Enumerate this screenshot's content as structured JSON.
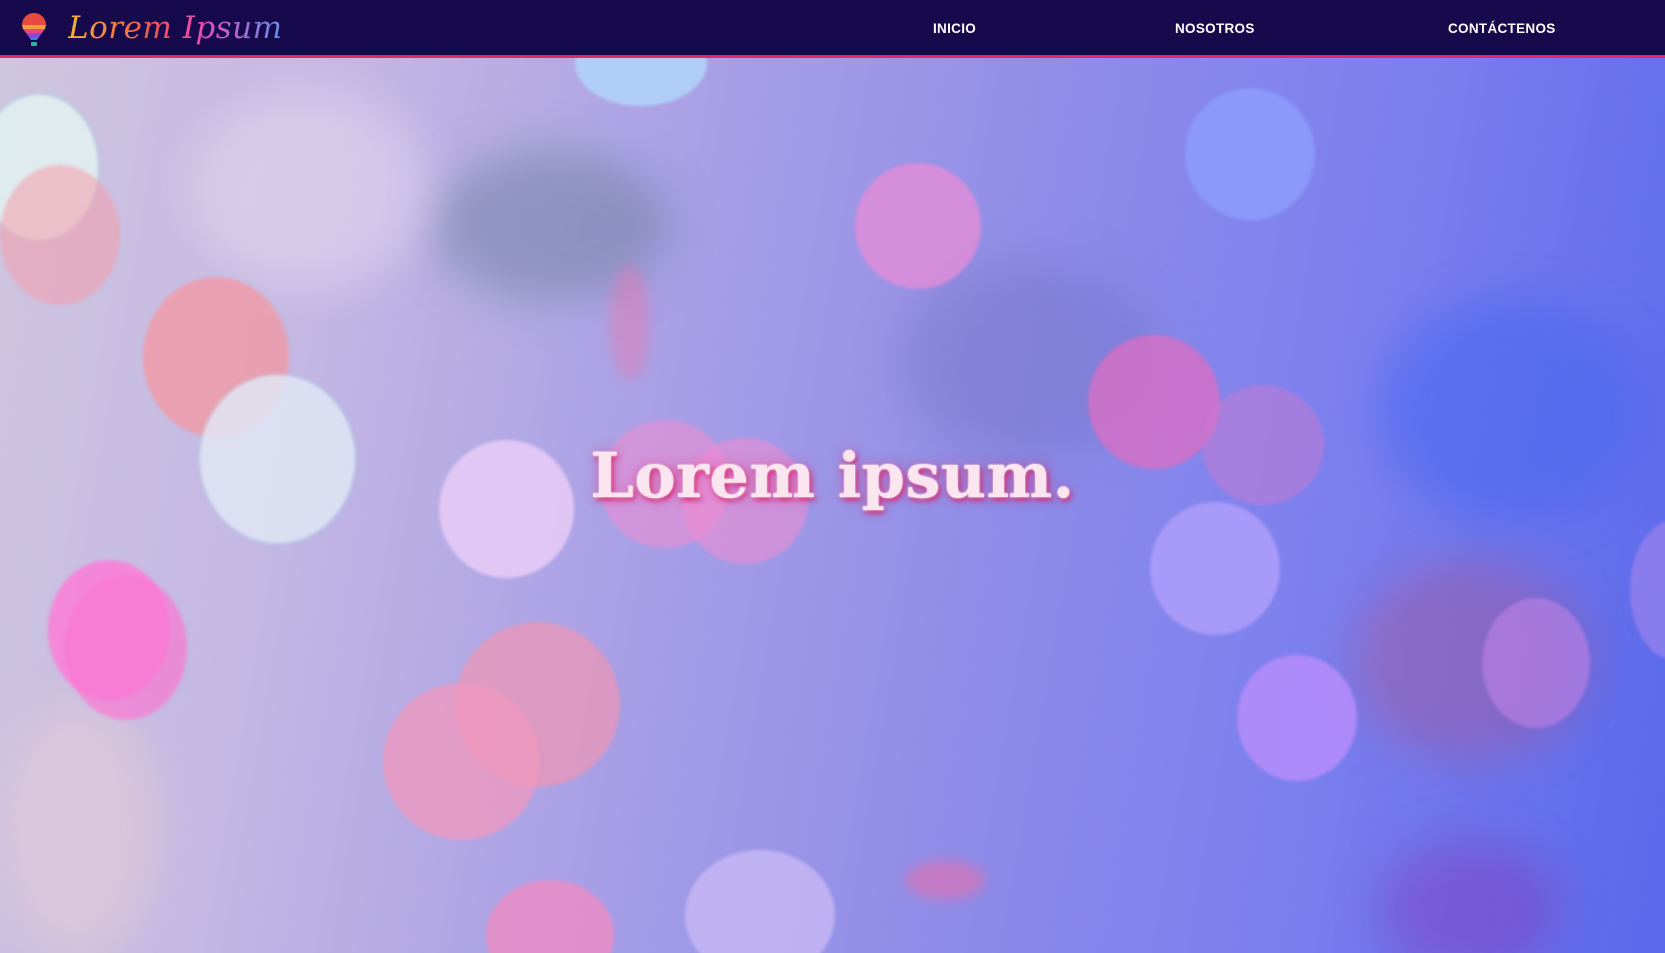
{
  "brand": {
    "name": "Lorem Ipsum",
    "logo_icon": "hot-air-balloon-icon"
  },
  "nav": {
    "items": [
      {
        "label": "INICIO"
      },
      {
        "label": "NOSOTROS"
      },
      {
        "label": "CONTÁCTENOS"
      }
    ]
  },
  "hero": {
    "title": "Lorem ipsum."
  },
  "colors": {
    "navbar_background": "#160a4c",
    "navbar_border": "#e8246b",
    "hero_text": "#fbe6f0",
    "hero_glow": "#d6246f"
  }
}
